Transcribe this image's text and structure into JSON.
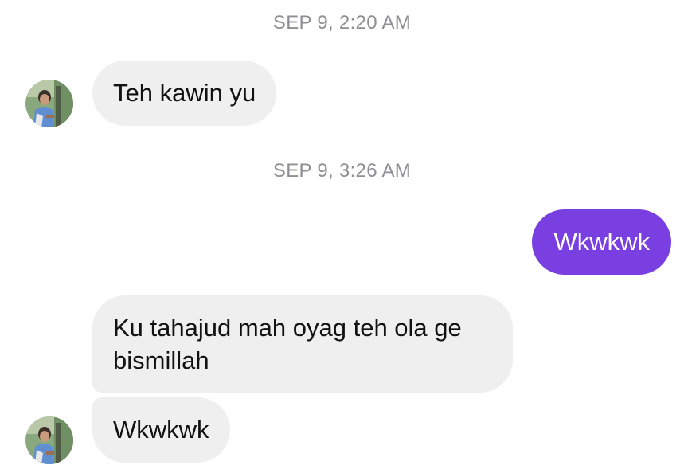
{
  "thread": {
    "timestamps": [
      "SEP 9, 2:20 AM",
      "SEP 9, 3:26 AM"
    ],
    "messages": [
      {
        "direction": "incoming",
        "text": "Teh kawin yu"
      },
      {
        "direction": "outgoing",
        "text": "Wkwkwk"
      },
      {
        "direction": "incoming",
        "text": "Ku tahajud mah oyag teh ola ge bismillah"
      },
      {
        "direction": "incoming",
        "text": "Wkwkwk"
      }
    ]
  },
  "colors": {
    "incoming_bubble": "#efefef",
    "outgoing_bubble": "#7a3fe0",
    "timestamp_text": "#8e8e93"
  },
  "icons": {
    "avatar": "contact-avatar-photo"
  }
}
